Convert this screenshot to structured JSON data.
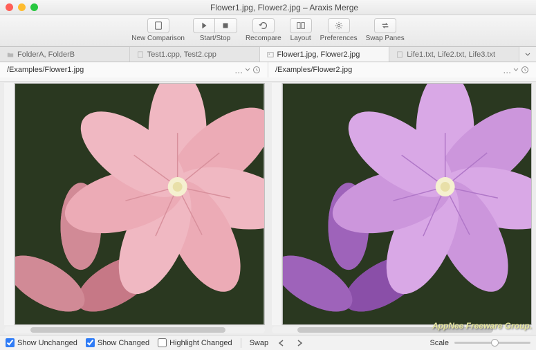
{
  "window": {
    "title": "Flower1.jpg, Flower2.jpg – Araxis Merge"
  },
  "toolbar": {
    "new_comparison": "New Comparison",
    "start_stop": "Start/Stop",
    "recompare": "Recompare",
    "layout": "Layout",
    "preferences": "Preferences",
    "swap_panes": "Swap Panes"
  },
  "tabs": [
    {
      "label": "FolderA, FolderB",
      "icon": "folder"
    },
    {
      "label": "Test1.cpp, Test2.cpp",
      "icon": "file"
    },
    {
      "label": "Flower1.jpg, Flower2.jpg",
      "icon": "image",
      "active": true
    },
    {
      "label": "Life1.txt, Life2.txt, Life3.txt",
      "icon": "file"
    }
  ],
  "paths": {
    "left": "/Examples/Flower1.jpg",
    "right": "/Examples/Flower2.jpg",
    "ellipsis": "..."
  },
  "images": {
    "left": {
      "name": "Flower1.jpg",
      "tint": "pink",
      "petal_fill": "#e9a6b0",
      "petal_dark": "#c67886",
      "center": "#f5f0d0"
    },
    "right": {
      "name": "Flower2.jpg",
      "tint": "purple",
      "petal_fill": "#c88dd8",
      "petal_dark": "#8a4fa8",
      "center": "#f5f0d0"
    }
  },
  "footer": {
    "show_unchanged": "Show Unchanged",
    "show_changed": "Show Changed",
    "highlight_changed": "Highlight Changed",
    "swap": "Swap",
    "scale": "Scale",
    "checked_unchanged": true,
    "checked_changed": true,
    "checked_highlight": false
  },
  "watermark": "AppNee Freeware Group."
}
